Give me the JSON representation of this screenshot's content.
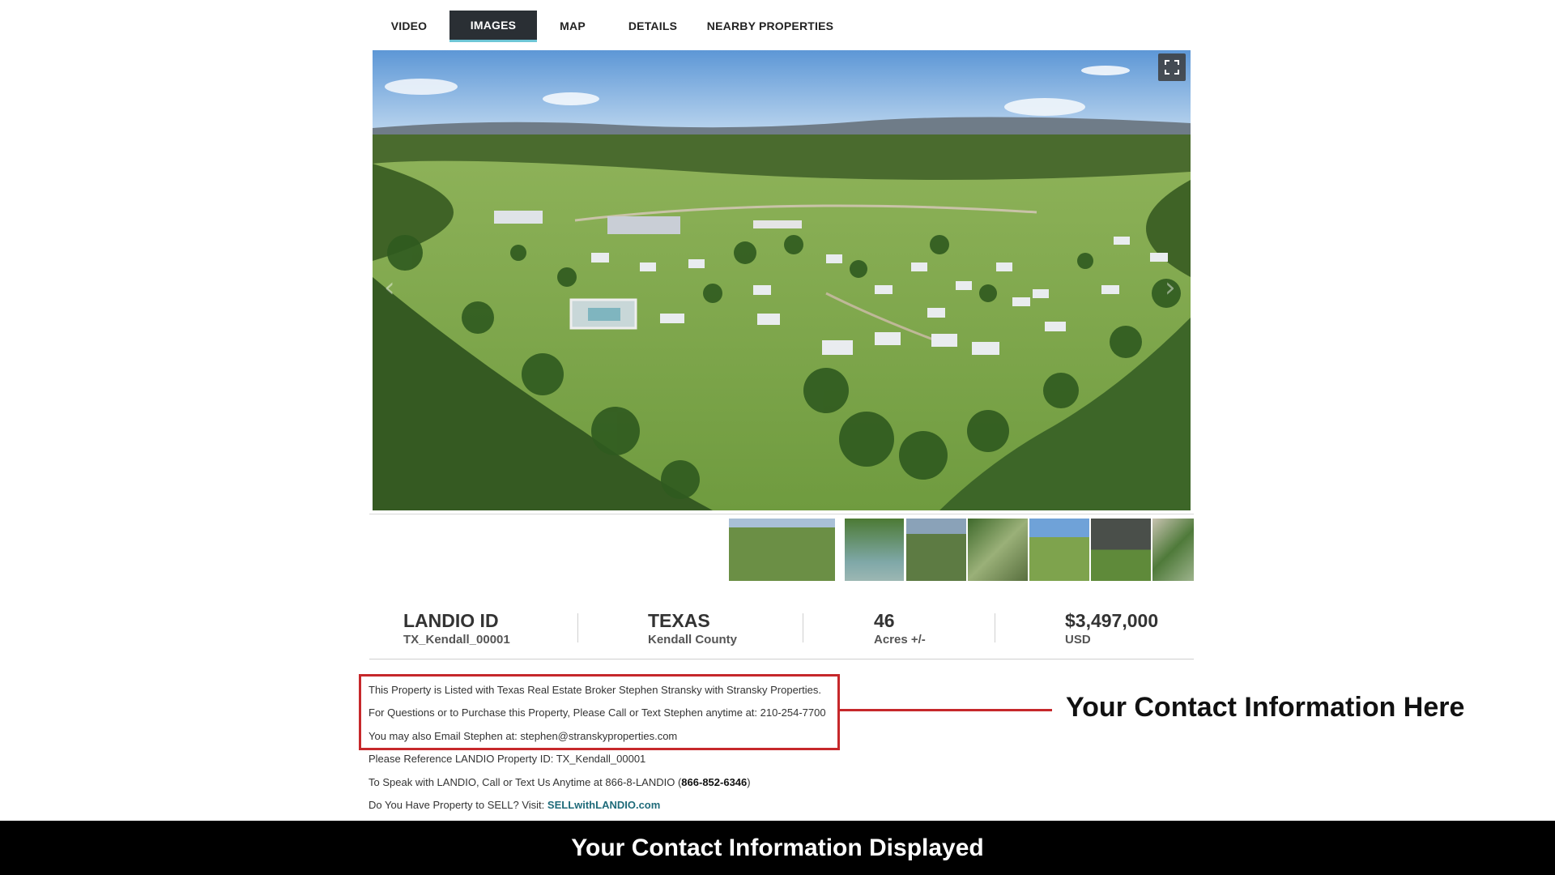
{
  "tabs": [
    {
      "label": "VIDEO",
      "active": false
    },
    {
      "label": "IMAGES",
      "active": true
    },
    {
      "label": "MAP",
      "active": false
    },
    {
      "label": "DETAILS",
      "active": false
    },
    {
      "label": "NEARBY PROPERTIES",
      "active": false
    }
  ],
  "gallery": {
    "main_image": "aerial photo of ranch land with scattered cabins, pool and trees",
    "fullscreen_icon": "expand-icon",
    "prev_icon": "chevron-left-icon",
    "next_icon": "chevron-right-icon",
    "thumbnail_count": 7
  },
  "stats": {
    "id_label": "LANDIO ID",
    "id_value": "TX_Kendall_00001",
    "state": "TEXAS",
    "county": "Kendall County",
    "acres": "46",
    "acres_unit": "Acres +/-",
    "price": "$3,497,000",
    "currency": "USD"
  },
  "info": {
    "line1": "This Property is Listed with Texas Real Estate Broker Stephen Stransky with Stransky Properties.",
    "line2": "For Questions or to Purchase this Property, Please Call or Text Stephen anytime at: 210-254-7700",
    "line3": "You may also Email Stephen at: stephen@stranskyproperties.com",
    "line4": "Please Reference LANDIO Property ID: TX_Kendall_00001",
    "line5_prefix": "To Speak with LANDIO, Call or Text Us Anytime at 866-8-LANDIO (",
    "line5_phone": "866-852-6346",
    "line5_suffix": ")",
    "line6_prefix": "Do You Have Property to SELL? Visit: ",
    "line6_link": "SELLwithLANDIO.com"
  },
  "callout": "Your Contact Information Here",
  "banner": "Your Contact Information Displayed",
  "colors": {
    "highlight": "#c6282b",
    "tab_active": "#2a2f34",
    "link": "#1f6b7a"
  }
}
